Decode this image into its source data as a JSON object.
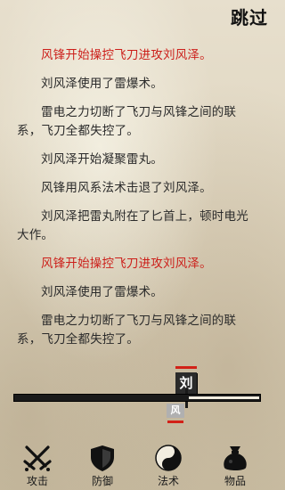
{
  "header": {
    "skip_label": "跳过"
  },
  "battle_log": [
    {
      "text": "风锋开始操控飞刀进攻刘风泽。",
      "highlight": true
    },
    {
      "text": "刘风泽使用了雷爆术。",
      "highlight": false
    },
    {
      "text": "雷电之力切断了飞刀与风锋之间的联系，飞刀全都失控了。",
      "highlight": false
    },
    {
      "text": "刘风泽开始凝聚雷丸。",
      "highlight": false
    },
    {
      "text": "风锋用风系法术击退了刘风泽。",
      "highlight": false
    },
    {
      "text": "刘风泽把雷丸附在了匕首上，顿时电光大作。",
      "highlight": false
    },
    {
      "text": "风锋开始操控飞刀进攻刘风泽。",
      "highlight": true
    },
    {
      "text": "刘风泽使用了雷爆术。",
      "highlight": false
    },
    {
      "text": "雷电之力切断了飞刀与风锋之间的联系，飞刀全都失控了。",
      "highlight": false
    }
  ],
  "timeline": {
    "top_marker_label": "刘",
    "bottom_marker_label": "风"
  },
  "nav": {
    "attack": "攻击",
    "defend": "防御",
    "spell": "法术",
    "items": "物品"
  },
  "colors": {
    "highlight_text": "#cc1f1a",
    "normal_text": "#2a2a2a",
    "marker_red": "#d22118"
  },
  "icons": {
    "attack": "crossed-swords-icon",
    "defend": "shield-icon",
    "spell": "yin-yang-icon",
    "items": "bag-icon"
  }
}
